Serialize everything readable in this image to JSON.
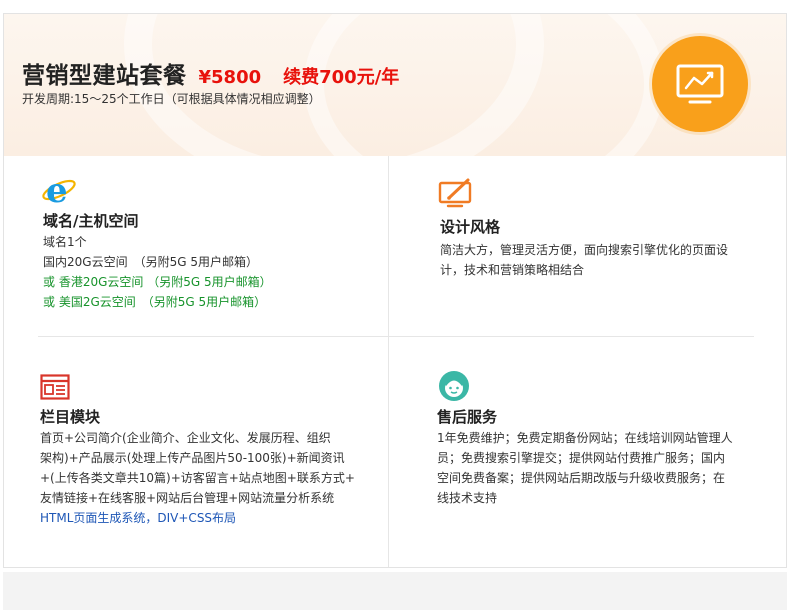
{
  "header": {
    "title": "营销型建站套餐",
    "price": "¥5800",
    "renewal": "续费700元/年",
    "period": "开发周期:15～25个工作日（可根据具体情况相应调整）",
    "badge_icon": "chart-monitor-icon",
    "badge_color": "#f9a01b"
  },
  "sections": {
    "domain": {
      "icon": "ie-browser-icon",
      "title": "域名/主机空间",
      "lines": [
        "域名1个",
        "国内20G云空间　（另附5G 5用户邮箱）",
        "或 香港20G云空间 （另附5G 5用户邮箱）",
        "或 美国2G云空间　（另附5G 5用户邮箱）"
      ]
    },
    "design": {
      "icon": "design-pen-icon",
      "title": "设计风格",
      "lines": [
        "简洁大方，管理灵活方便，面向搜索引擎优化的页面设",
        "计，技术和营销策略相结合"
      ]
    },
    "modules": {
      "icon": "browser-window-icon",
      "title": "栏目模块",
      "lines": [
        "首页+公司简介(企业简介、企业文化、发展历程、组织",
        "架构)+产品展示(处理上传产品图片50-100张)+新闻资讯",
        "+(上传各类文章共10篇)+访客留言+站点地图+联系方式+",
        "友情链接+在线客服+网站后台管理+网站流量分析系统",
        "HTML页面生成系统，DIV+CSS布局"
      ]
    },
    "service": {
      "icon": "customer-service-icon",
      "title": "售后服务",
      "lines": [
        "1年免费维护；免费定期备份网站；在线培训网站管理人",
        "员；免费搜索引擎提交；提供网站付费推广服务；国内",
        "空间免费备案；提供网站后期改版与升级收费服务；在",
        "线技术支持"
      ]
    }
  },
  "colors": {
    "accent_red": "#e8120c",
    "green_text": "#17932b",
    "blue_text": "#1d56b6",
    "ie_blue": "#1a9be0",
    "design_orange": "#f07b24",
    "module_red": "#d9352a",
    "service_teal": "#3bb7a6"
  }
}
